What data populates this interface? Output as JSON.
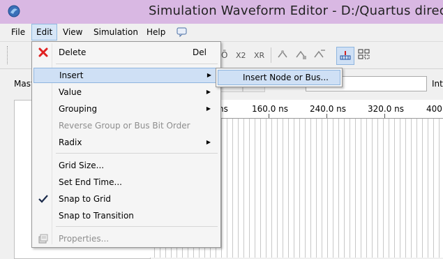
{
  "window": {
    "title": "Simulation Waveform Editor - D:/Quartus directo"
  },
  "menubar": {
    "items": [
      "File",
      "Edit",
      "View",
      "Simulation",
      "Help"
    ]
  },
  "search": {
    "master_label": "Mast",
    "int_label": "Int"
  },
  "timebar": {
    "ticks": [
      "ns",
      "160.0 ns",
      "240.0 ns",
      "320.0 ns",
      "400."
    ]
  },
  "edit_menu": {
    "delete": {
      "label": "Delete",
      "shortcut": "Del"
    },
    "insert": {
      "label": "Insert"
    },
    "value": {
      "label": "Value"
    },
    "grouping": {
      "label": "Grouping"
    },
    "reverse": {
      "label": "Reverse Group or Bus Bit Order"
    },
    "radix": {
      "label": "Radix"
    },
    "grid_size": {
      "label": "Grid Size..."
    },
    "set_end_time": {
      "label": "Set End Time..."
    },
    "snap_to_grid": {
      "label": "Snap to Grid",
      "checked": true
    },
    "snap_to_transition": {
      "label": "Snap to Transition"
    },
    "properties": {
      "label": "Properties..."
    }
  },
  "insert_submenu": {
    "items": [
      "Insert Node or Bus..."
    ]
  },
  "colors": {
    "titlebar": "#d9b8e3",
    "highlight": "#cfe0f5",
    "delete_icon": "#e02020"
  },
  "icons": [
    "app-icon",
    "delete-icon",
    "check-icon",
    "properties-icon",
    "help-icon"
  ]
}
